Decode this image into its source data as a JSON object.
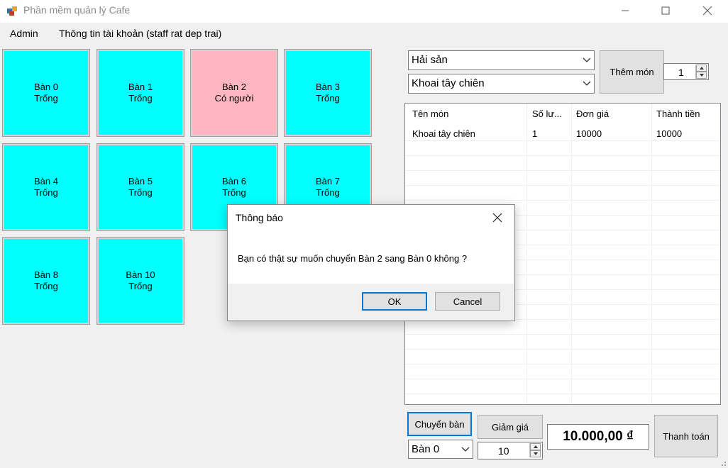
{
  "window": {
    "title": "Phần mềm quản lý Cafe"
  },
  "menu": {
    "admin": "Admin",
    "account": "Thông tin tài khoản (staff rat dep trai)"
  },
  "tables": [
    {
      "name": "Bàn 0",
      "status": "Trống",
      "state": "free"
    },
    {
      "name": "Bàn 1",
      "status": "Trống",
      "state": "free"
    },
    {
      "name": "Bàn 2",
      "status": "Có người",
      "state": "busy"
    },
    {
      "name": "Bàn 3",
      "status": "Trống",
      "state": "free"
    },
    {
      "name": "Bàn 4",
      "status": "Trống",
      "state": "free"
    },
    {
      "name": "Bàn 5",
      "status": "Trống",
      "state": "free"
    },
    {
      "name": "Bàn 6",
      "status": "Trống",
      "state": "free"
    },
    {
      "name": "Bàn 7",
      "status": "Trống",
      "state": "free"
    },
    {
      "name": "Bàn 8",
      "status": "Trống",
      "state": "free"
    },
    {
      "name": "Bàn 10",
      "status": "Trống",
      "state": "free"
    }
  ],
  "colors": {
    "free": "#00ffff",
    "busy": "#ffb6c1",
    "accent": "#0078d7"
  },
  "order": {
    "category": "Hải sản",
    "food": "Khoai tây chiên",
    "add_label": "Thêm món",
    "quantity": "1"
  },
  "bill": {
    "columns": [
      "Tên món",
      "Số lư...",
      "Đơn giá",
      "Thành tiền"
    ],
    "rows": [
      [
        "Khoai tây chiên",
        "1",
        "10000",
        "10000"
      ]
    ]
  },
  "footer": {
    "switch_label": "Chuyển bàn",
    "switch_target": "Bàn 0",
    "discount_label": "Giảm giá",
    "discount_value": "10",
    "total": "10.000,00 ₫",
    "pay_label": "Thanh toán"
  },
  "dialog": {
    "title": "Thông báo",
    "message": "Bạn có thật sự muốn chuyển Bàn 2 sang Bàn 0 không ?",
    "ok": "OK",
    "cancel": "Cancel"
  }
}
